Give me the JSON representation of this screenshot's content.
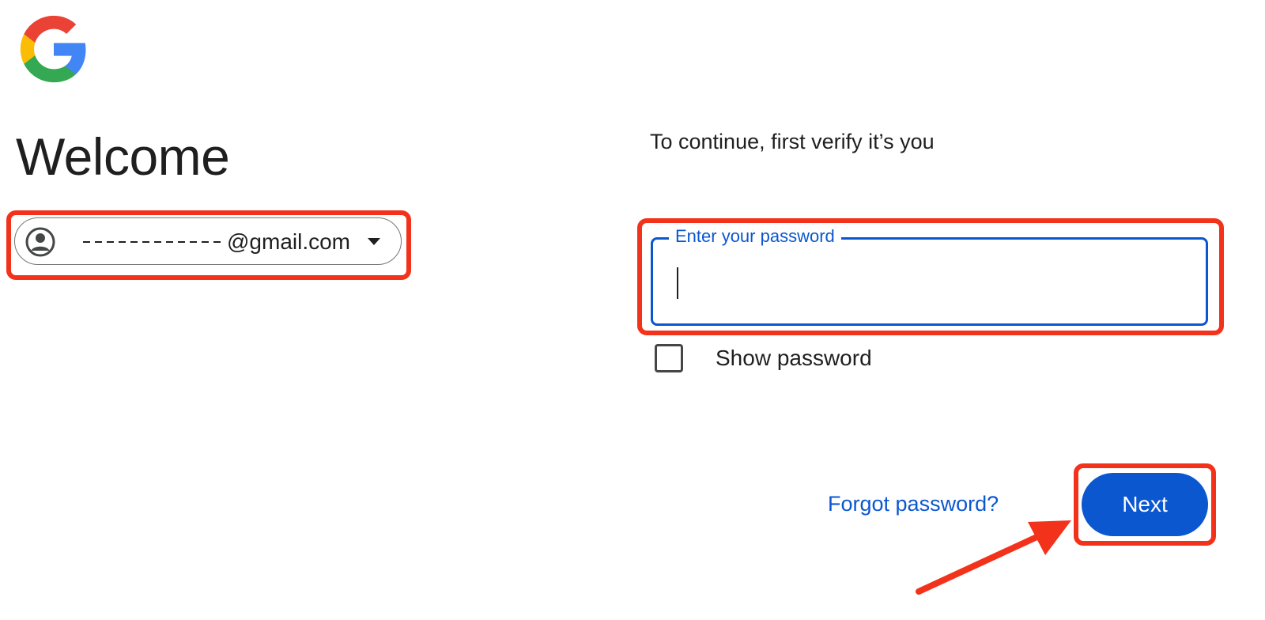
{
  "branding": {
    "logo_icon": "google-g-logo"
  },
  "welcome": {
    "title": "Welcome"
  },
  "account": {
    "email_suffix": "@gmail.com",
    "avatar_icon": "account-circle-icon",
    "dropdown_icon": "chevron-down-icon"
  },
  "verify": {
    "instruction": "To continue, first verify it’s you"
  },
  "password_field": {
    "label": "Enter your password",
    "value": ""
  },
  "show_password": {
    "label": "Show password",
    "checked": false
  },
  "actions": {
    "forgot_label": "Forgot password?",
    "next_label": "Next"
  },
  "colors": {
    "accent": "#0b57d0",
    "text": "#1f1f1f",
    "annotation": "#f3321c",
    "google_blue": "#4285f4",
    "google_red": "#ea4335",
    "google_yellow": "#fbbc05",
    "google_green": "#34a853"
  },
  "annotations": {
    "highlight_boxes": 3,
    "arrow_icon": "red-arrow-icon"
  }
}
